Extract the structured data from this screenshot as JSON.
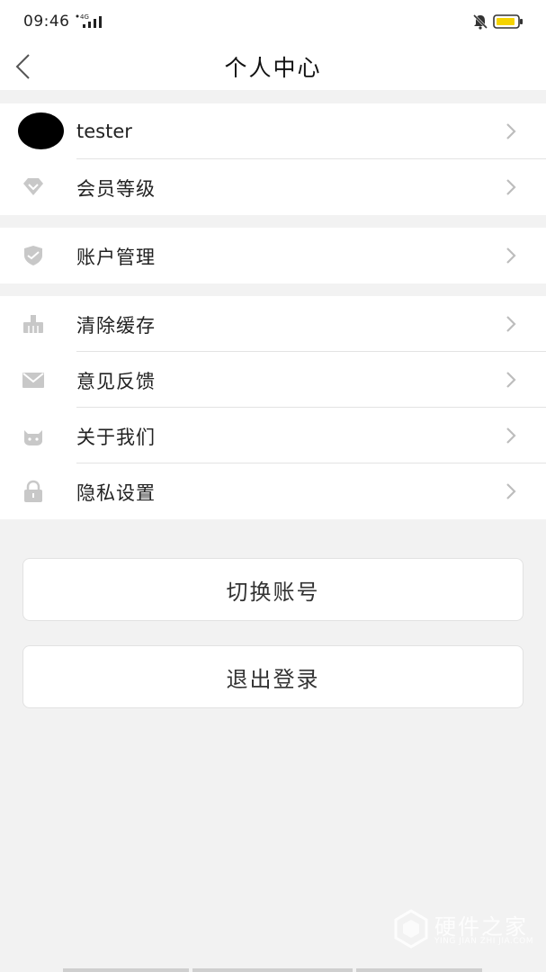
{
  "status_bar": {
    "time": "09:46",
    "network": "4G"
  },
  "header": {
    "title": "个人中心"
  },
  "profile": {
    "username": "tester"
  },
  "groups": [
    {
      "items": [
        {
          "label": "会员等级",
          "icon": "diamond-icon"
        }
      ]
    },
    {
      "items": [
        {
          "label": "账户管理",
          "icon": "shield-icon"
        }
      ]
    },
    {
      "items": [
        {
          "label": "清除缓存",
          "icon": "broom-icon"
        },
        {
          "label": "意见反馈",
          "icon": "mail-icon"
        },
        {
          "label": "关于我们",
          "icon": "cat-icon"
        },
        {
          "label": "隐私设置",
          "icon": "lock-icon"
        }
      ]
    }
  ],
  "buttons": {
    "switch_account": "切换账号",
    "logout": "退出登录"
  },
  "watermark": {
    "title": "硬件之家",
    "subtitle": "YING JIAN ZHI JIA.COM"
  },
  "colors": {
    "background": "#f2f2f2",
    "icon_gray": "#c8c8c8",
    "battery_fill": "#f5d300"
  }
}
